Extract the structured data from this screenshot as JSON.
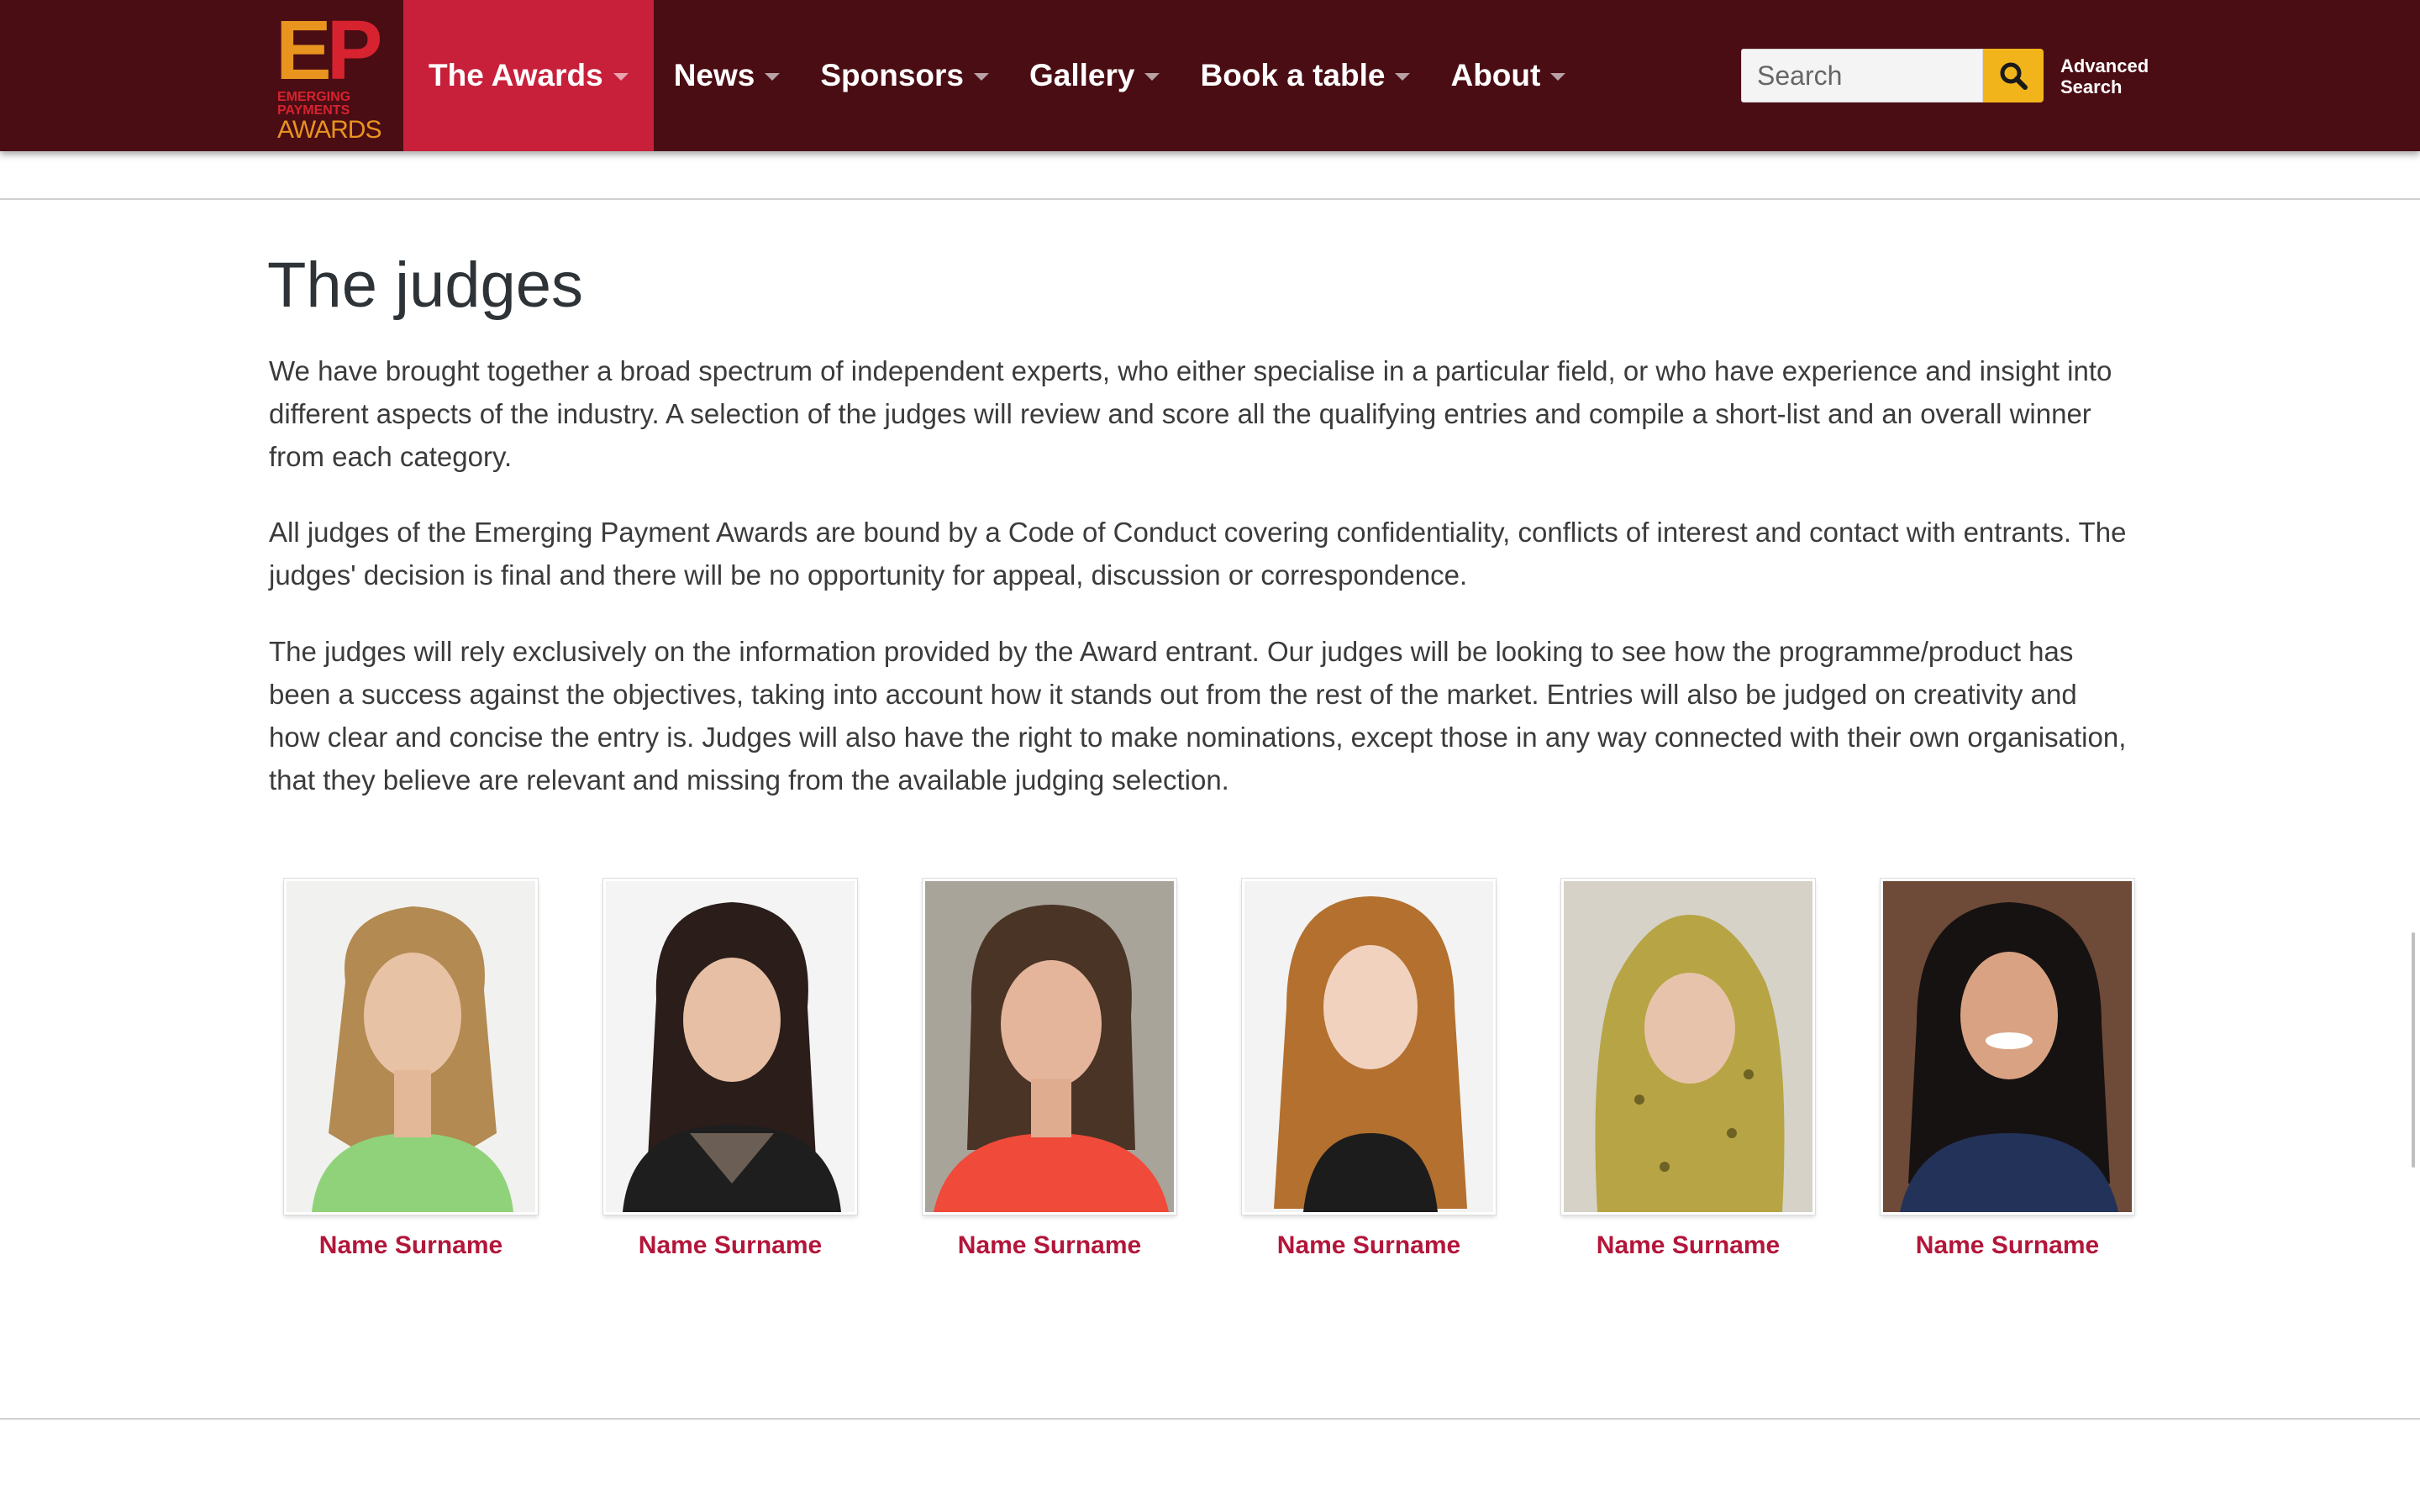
{
  "logo": {
    "letter_e": "E",
    "letter_p": "P",
    "line1": "EMERGING",
    "line2": "PAYMENTS",
    "line3": "AWARDS"
  },
  "nav": {
    "items": [
      {
        "label": "The Awards"
      },
      {
        "label": "News"
      },
      {
        "label": "Sponsors"
      },
      {
        "label": "Gallery"
      },
      {
        "label": "Book a table"
      },
      {
        "label": "About"
      }
    ]
  },
  "search": {
    "placeholder": "Search",
    "advanced_line1": "Advanced",
    "advanced_line2": "Search"
  },
  "main": {
    "title": "The judges",
    "paragraphs": [
      "We have brought together a broad spectrum of independent experts, who either specialise in a particular field, or who have experience and insight into different aspects of the industry. A selection of the judges will review and score all the qualifying entries and compile a short-list and an overall winner from each category.",
      "All judges of the Emerging Payment Awards are bound by a Code of Conduct covering confidentiality, conflicts of interest and contact with entrants. The judges' decision is final and there will be no opportunity for appeal, discussion or correspondence.",
      "The judges will rely exclusively on the information provided by the Award entrant. Our judges will be looking to see how the programme/product has been a success against the objectives, taking into account how it stands out from the rest of the market. Entries will also be judged on creativity and how clear and concise the entry is. Judges will also have the right to make nominations, except those in any way connected with their own organisation, that they believe are relevant and missing from the available judging selection."
    ]
  },
  "judges": [
    {
      "name": "Name Surname"
    },
    {
      "name": "Name Surname"
    },
    {
      "name": "Name Surname"
    },
    {
      "name": "Name Surname"
    },
    {
      "name": "Name Surname"
    },
    {
      "name": "Name Surname"
    }
  ],
  "colors": {
    "header_bg": "#4a0d14",
    "nav_active": "#c8203a",
    "search_button": "#f2b41b",
    "judge_name": "#b3163a"
  }
}
